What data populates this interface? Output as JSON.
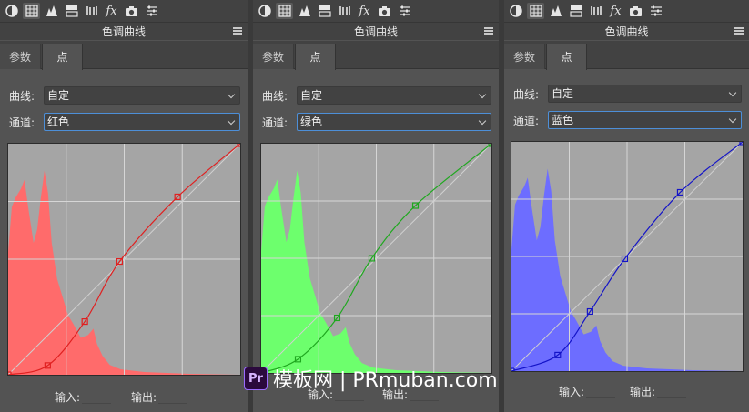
{
  "toolbar_icons": [
    "brightness-contrast-icon",
    "curves-grid-icon",
    "levels-icon",
    "exposure-icon",
    "split-icon",
    "fx-icon",
    "camera-icon",
    "sliders-icon"
  ],
  "panels": [
    {
      "title": "色调曲线",
      "tabs": [
        "参数",
        "点"
      ],
      "curve_label": "曲线:",
      "curve_value": "自定",
      "channel_label": "通道:",
      "channel_value": "红色",
      "input_label": "输入:",
      "output_label": "输出:",
      "curve_color": "#e02020",
      "histogram_color": "#ff6b6b",
      "points": [
        [
          0,
          0
        ],
        [
          0.17,
          0.04
        ],
        [
          0.33,
          0.23
        ],
        [
          0.48,
          0.49
        ],
        [
          0.73,
          0.77
        ],
        [
          1,
          1
        ]
      ]
    },
    {
      "title": "色调曲线",
      "tabs": [
        "参数",
        "点"
      ],
      "curve_label": "曲线:",
      "curve_value": "自定",
      "channel_label": "通道:",
      "channel_value": "绿色",
      "input_label": "输入:",
      "output_label": "输出:",
      "curve_color": "#1fa81f",
      "histogram_color": "#6dff6d",
      "points": [
        [
          0,
          0
        ],
        [
          0.16,
          0.06
        ],
        [
          0.33,
          0.24
        ],
        [
          0.48,
          0.5
        ],
        [
          0.67,
          0.73
        ],
        [
          1,
          1
        ]
      ]
    },
    {
      "title": "色调曲线",
      "tabs": [
        "参数",
        "点"
      ],
      "curve_label": "曲线:",
      "curve_value": "自定",
      "channel_label": "通道:",
      "channel_value": "蓝色",
      "input_label": "输入:",
      "output_label": "输出:",
      "curve_color": "#1414c8",
      "histogram_color": "#6d6dff",
      "points": [
        [
          0,
          0
        ],
        [
          0.2,
          0.07
        ],
        [
          0.34,
          0.26
        ],
        [
          0.49,
          0.49
        ],
        [
          0.73,
          0.78
        ],
        [
          1,
          1
        ]
      ]
    }
  ],
  "watermark": {
    "logo": "Pr",
    "text": "模板网 | PRmuban.com"
  }
}
